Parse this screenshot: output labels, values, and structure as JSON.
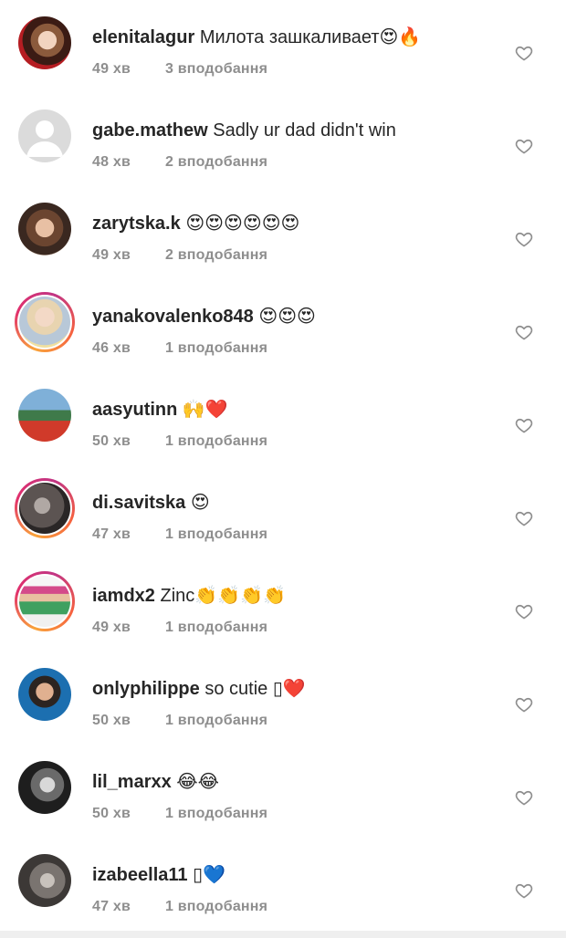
{
  "comments": [
    {
      "username": "elenitalagur",
      "text": "Милота зашкаливает😍🔥",
      "time": "49 хв",
      "likes": "3 вподобання",
      "story": false
    },
    {
      "username": "gabe.mathew",
      "text": "Sadly ur dad didn't win",
      "time": "48 хв",
      "likes": "2 вподобання",
      "story": false
    },
    {
      "username": "zarytska.k",
      "text": "😍😍😍😍😍😍",
      "time": "49 хв",
      "likes": "2 вподобання",
      "story": false
    },
    {
      "username": "yanakovalenko848",
      "text": "😍😍😍",
      "time": "46 хв",
      "likes": "1 вподобання",
      "story": true
    },
    {
      "username": "aasyutinn",
      "text": "🙌❤️",
      "time": "50 хв",
      "likes": "1 вподобання",
      "story": false
    },
    {
      "username": "di.savitska",
      "text": "😍",
      "time": "47 хв",
      "likes": "1 вподобання",
      "story": true
    },
    {
      "username": "iamdx2",
      "text": "Zinc👏👏👏👏",
      "time": "49 хв",
      "likes": "1 вподобання",
      "story": true
    },
    {
      "username": "onlyphilippe",
      "text": "so cutie ▯❤️",
      "time": "50 хв",
      "likes": "1 вподобання",
      "story": false
    },
    {
      "username": "lil_marxx",
      "text": "😂😂",
      "time": "50 хв",
      "likes": "1 вподобання",
      "story": false
    },
    {
      "username": "izabeella11",
      "text": "▯💙",
      "time": "47 хв",
      "likes": "1 вподобання",
      "story": false
    }
  ],
  "icons": {
    "like": "heart-outline-icon"
  },
  "colors": {
    "text": "#262626",
    "meta": "#8e8e8e",
    "story_ring_start": "#f9a33a",
    "story_ring_end": "#c13584"
  }
}
